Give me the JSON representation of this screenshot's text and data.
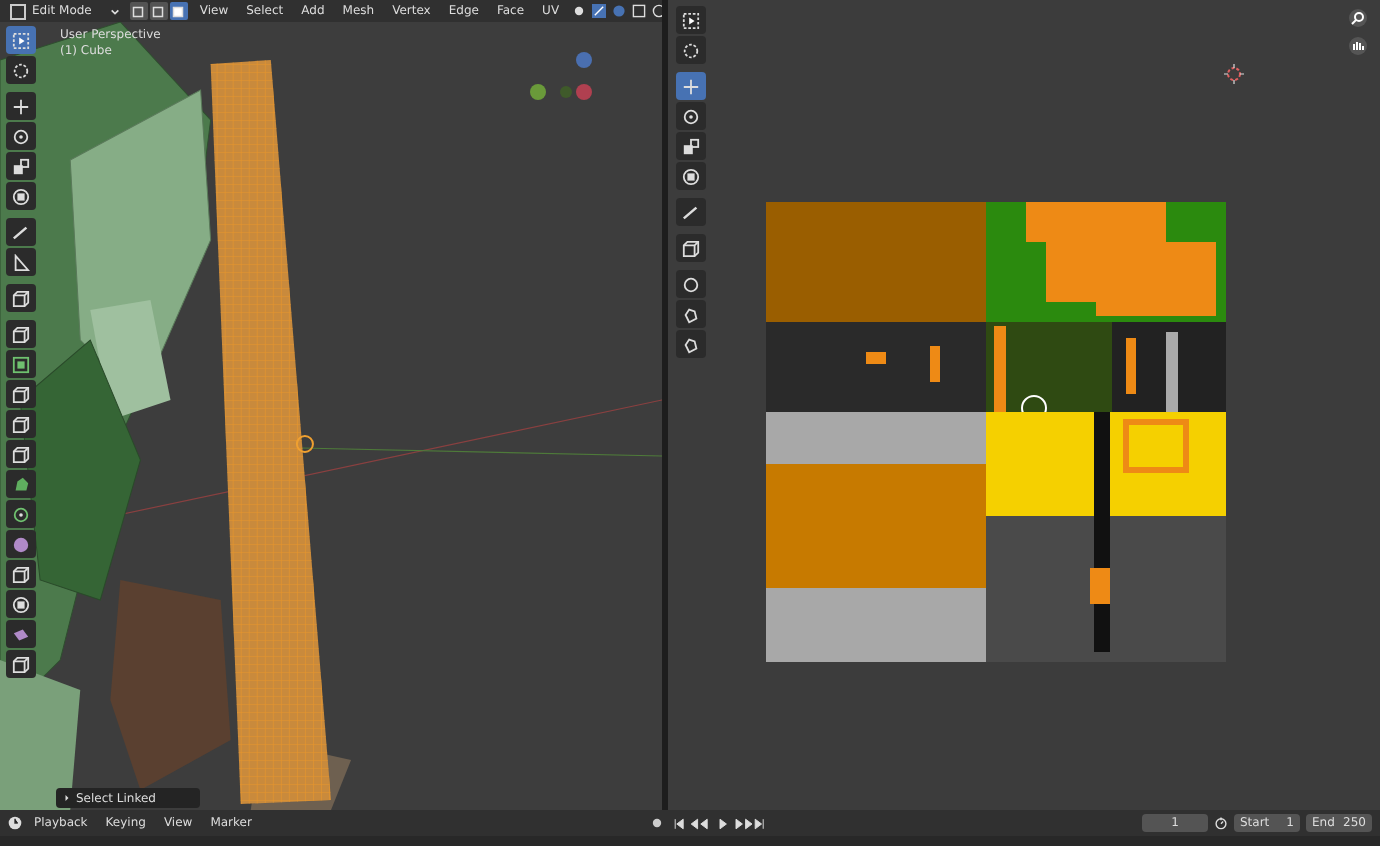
{
  "header": {
    "mode": "Edit Mode",
    "select_modes": [
      {
        "selected": false
      },
      {
        "selected": false
      },
      {
        "selected": true
      }
    ],
    "menus": [
      "View",
      "Select",
      "Add",
      "Mesh",
      "Vertex",
      "Edge",
      "Face",
      "UV"
    ]
  },
  "viewport": {
    "view_name": "User Perspective",
    "object_name": "(1) Cube",
    "tool_groups": [
      [
        {
          "selected": true
        },
        {
          "selected": false
        }
      ],
      [
        {
          "selected": false
        },
        {
          "selected": false
        },
        {
          "selected": false
        },
        {
          "selected": false
        }
      ],
      [
        {
          "selected": false
        },
        {
          "selected": false
        }
      ],
      [
        {
          "selected": false
        }
      ],
      [
        {
          "selected": false
        },
        {
          "selected": false
        },
        {
          "selected": false
        },
        {
          "selected": false
        },
        {
          "selected": false
        },
        {
          "selected": false
        },
        {
          "selected": false
        },
        {
          "selected": false
        },
        {
          "selected": false
        },
        {
          "selected": false
        },
        {
          "selected": false
        },
        {
          "selected": false
        }
      ]
    ]
  },
  "operator_panel": {
    "label": "Select Linked",
    "expanded": false
  },
  "uv_editor": {
    "tool_groups": [
      [
        {
          "selected": false
        },
        {
          "selected": false
        }
      ],
      [
        {
          "selected": true
        },
        {
          "selected": false
        },
        {
          "selected": false
        },
        {
          "selected": false
        }
      ],
      [
        {
          "selected": false
        }
      ],
      [
        {
          "selected": false
        }
      ],
      [
        {
          "selected": false
        },
        {
          "selected": false
        },
        {
          "selected": false
        }
      ]
    ]
  },
  "timeline": {
    "menus": [
      "Playback",
      "Keying",
      "View",
      "Marker"
    ],
    "current_frame": "1",
    "start_label": "Start",
    "start": "1",
    "end_label": "End",
    "end": "250"
  }
}
